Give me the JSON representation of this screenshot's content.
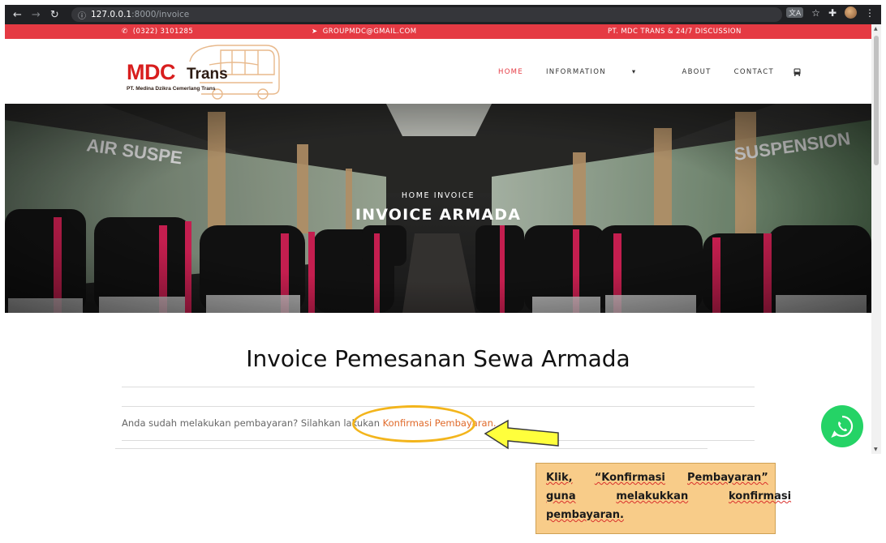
{
  "browser": {
    "url_host": "127.0.0.1",
    "url_path": ":8000/invoice",
    "back_icon": "arrow-left",
    "forward_icon": "arrow-right",
    "reload_icon": "reload"
  },
  "topbar": {
    "phone": "(0322) 3101285",
    "email": "GROUPMDC@GMAIL.COM",
    "tagline": "PT. MDC TRANS & 24/7 DISCUSSION"
  },
  "logo": {
    "brand": "MDC",
    "brand_suffix": "Trans",
    "company": "PT. Medina Dzikra Cemerlang Trans"
  },
  "menu": {
    "home": "HOME",
    "information": "INFORMATION",
    "about": "ABOUT",
    "contact": "CONTACT"
  },
  "hero": {
    "breadcrumb": "HOME  INVOICE",
    "title": "INVOICE ARMADA"
  },
  "content": {
    "title": "Invoice Pemesanan Sewa Armada",
    "notice_text": "Anda sudah melakukan pembayaran? Silahkan lakukan ",
    "notice_link": "Konfirmasi Pembayaran."
  },
  "annotation": {
    "word1": "Klik,",
    "word2": "“Konfirmasi",
    "word3": "Pembayaran”",
    "word4": "guna",
    "word5": "melakukkan",
    "word6": "konfirmasi",
    "word7": "pembayaran."
  },
  "colors": {
    "accent_red": "#e53a43",
    "link_orange": "#e06a2a",
    "whatsapp_green": "#25d366",
    "annotation_yellow": "#f3b51c",
    "annotation_box": "#f8cc89"
  }
}
